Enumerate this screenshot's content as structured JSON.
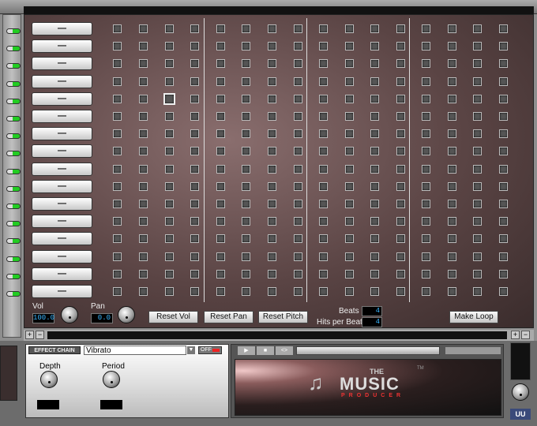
{
  "sequencer": {
    "rows": 16,
    "steps": 16,
    "instrument_label": "—",
    "selected_cell": {
      "row": 4,
      "step": 2
    },
    "vol_label": "Vol",
    "vol_value": "100.0",
    "pan_label": "Pan",
    "pan_value": "0.0",
    "reset_vol": "Reset Vol",
    "reset_pan": "Reset Pan",
    "reset_pitch": "Reset Pitch",
    "beats_label": "Beats",
    "beats_value": "4",
    "hits_label": "Hits per Beat",
    "hits_value": "4",
    "make_loop": "Make Loop"
  },
  "effects": {
    "chain_label": "EFFECT CHAIN",
    "selected": "Vibrato",
    "off_label": "OFF",
    "depth_label": "Depth",
    "period_label": "Period"
  },
  "player": {
    "play": "▶",
    "stop": "■",
    "loop": "<>"
  },
  "logo": {
    "the": "THE",
    "music": "MUSIC",
    "producer": "PRODUCER",
    "tm": "TM"
  },
  "side": {
    "uu_label": "UU"
  },
  "colors": {
    "led_on": "#22cc22",
    "lcd_text": "#3ab6ff"
  }
}
